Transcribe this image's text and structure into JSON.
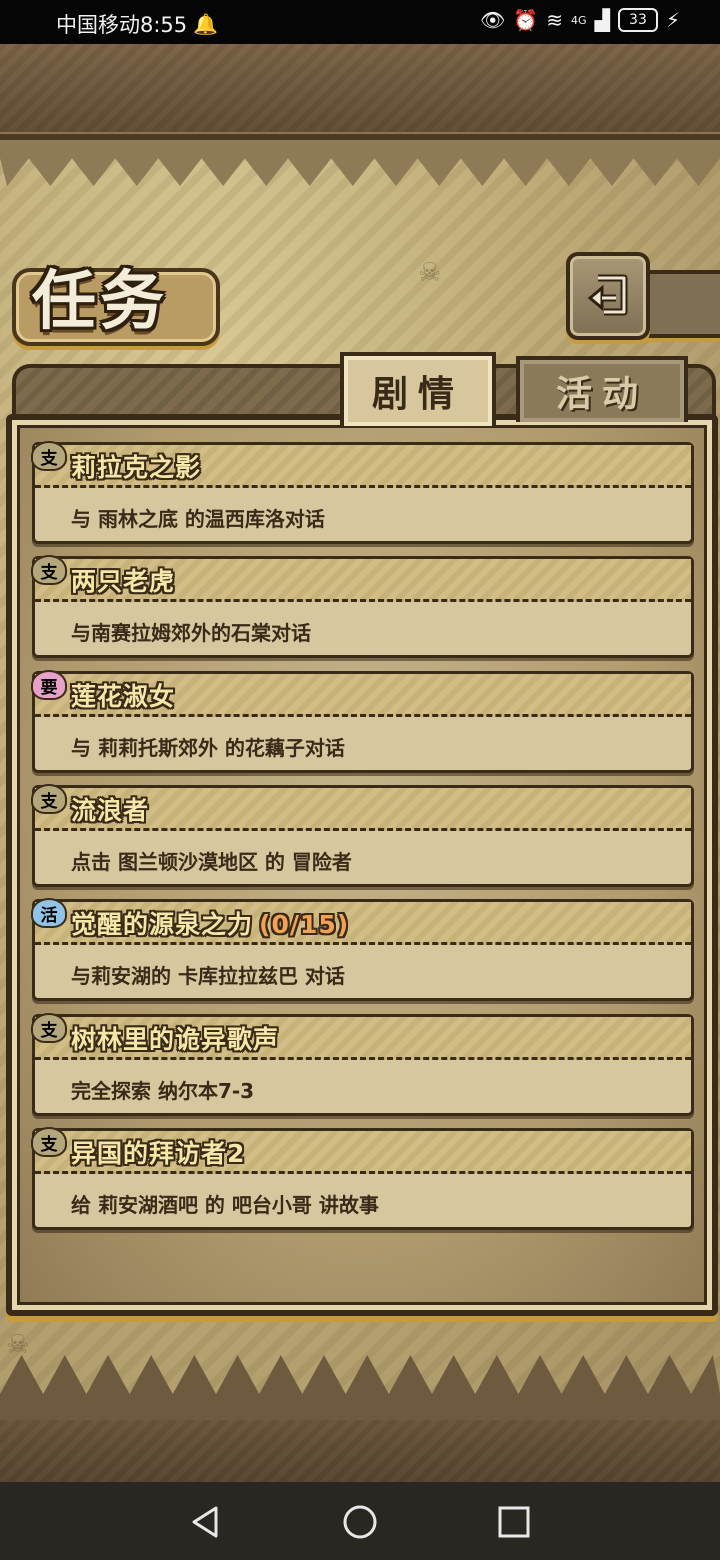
{
  "status_bar": {
    "carrier_time": "中国移动8:55",
    "battery": "33",
    "network": "4G"
  },
  "header": {
    "title": "任务",
    "back_icon": "return-arrow-icon"
  },
  "tabs": [
    {
      "label": "剧情",
      "active": true
    },
    {
      "label": "活动",
      "active": false
    }
  ],
  "quests": [
    {
      "icon": "支",
      "icon_color": "#b5a77c",
      "title": "莉拉克之影",
      "progress": "",
      "description": "与 雨林之底 的温西库洛对话"
    },
    {
      "icon": "支",
      "icon_color": "#b5a77c",
      "title": "两只老虎",
      "progress": "",
      "description": "与南赛拉姆郊外的石棠对话"
    },
    {
      "icon": "要",
      "icon_color": "#e8a2c8",
      "title": "莲花淑女",
      "progress": "",
      "description": "与 莉莉托斯郊外 的花藕子对话"
    },
    {
      "icon": "支",
      "icon_color": "#b5a77c",
      "title": "流浪者",
      "progress": "",
      "description": "点击 图兰顿沙漠地区 的 冒险者"
    },
    {
      "icon": "活",
      "icon_color": "#8fc4e8",
      "title": "觉醒的源泉之力",
      "progress": "(0/15)",
      "description": "与莉安湖的 卡库拉拉兹巴 对话"
    },
    {
      "icon": "支",
      "icon_color": "#b5a77c",
      "title": "树林里的诡异歌声",
      "progress": "",
      "description": "完全探索 纳尔本7-3"
    },
    {
      "icon": "支",
      "icon_color": "#b5a77c",
      "title": "异国的拜访者2",
      "progress": "",
      "description": "给 莉安湖酒吧 的 吧台小哥 讲故事"
    }
  ],
  "nav": {
    "back": "back-triangle-icon",
    "home": "home-circle-icon",
    "recent": "recent-square-icon"
  }
}
